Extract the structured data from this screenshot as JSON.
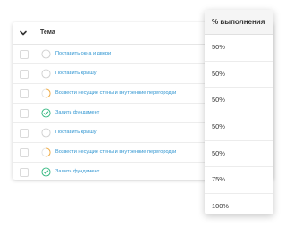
{
  "table": {
    "header": {
      "title": "Тема",
      "collapse_icon": "chevron-down-icon"
    },
    "rows": [
      {
        "label": "Поставить окна и двери",
        "status": "not-started"
      },
      {
        "label": "Поставить крышу",
        "status": "not-started"
      },
      {
        "label": "Возвести несущие стены и внутренние перегородки",
        "status": "in-progress"
      },
      {
        "label": "Залить фундамент",
        "status": "done"
      },
      {
        "label": "Поставить крышу",
        "status": "not-started"
      },
      {
        "label": "Возвести несущие стены и внутренние перегородки",
        "status": "in-progress"
      },
      {
        "label": "Залить фундамент",
        "status": "done"
      }
    ]
  },
  "column_popout": {
    "header": "% выполнения",
    "values": [
      "50%",
      "50%",
      "50%",
      "50%",
      "50%",
      "75%",
      "100%"
    ]
  },
  "colors": {
    "link": "#2f95d1",
    "status_not_started": "#cfcfcf",
    "status_in_progress": "#f2a93b",
    "status_done": "#2eb67d"
  }
}
